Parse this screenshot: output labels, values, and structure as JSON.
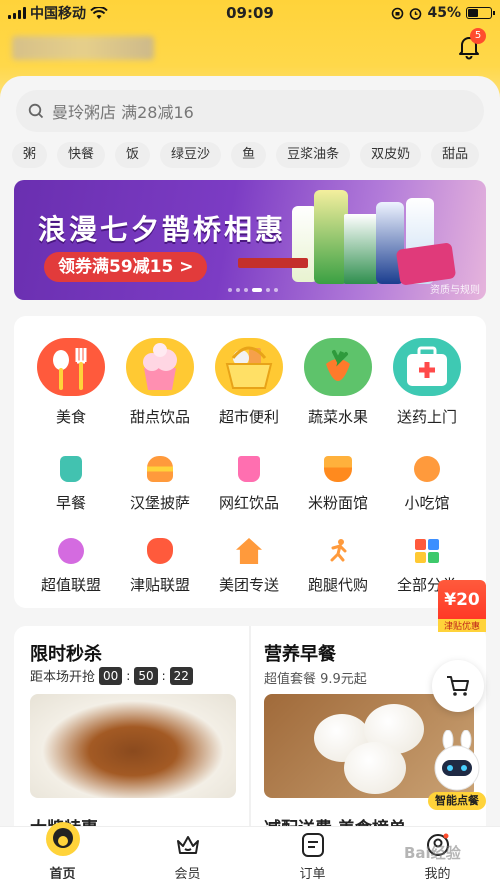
{
  "status_bar": {
    "carrier": "中国移动",
    "time": "09:09",
    "battery": "45%"
  },
  "header": {
    "notification_count": "5"
  },
  "search": {
    "placeholder": "曼玲粥店 满28减16"
  },
  "chips": [
    "粥",
    "快餐",
    "饭",
    "绿豆沙",
    "鱼",
    "豆浆油条",
    "双皮奶",
    "甜品"
  ],
  "banner": {
    "title": "浪漫七夕鹊桥相惠",
    "button": "领券满59减15 >",
    "note": "资质与规则"
  },
  "categories_main": [
    {
      "label": "美食",
      "color": "#ff5a3c"
    },
    {
      "label": "甜点饮品",
      "color": "#ffc933"
    },
    {
      "label": "超市便利",
      "color": "#ffc933"
    },
    {
      "label": "蔬菜水果",
      "color": "#5ec36b"
    },
    {
      "label": "送药上门",
      "color": "#3ec9b3"
    }
  ],
  "categories_row2": [
    "早餐",
    "汉堡披萨",
    "网红饮品",
    "米粉面馆",
    "小吃馆"
  ],
  "categories_row3": [
    "超值联盟",
    "津贴联盟",
    "美团专送",
    "跑腿代购",
    "全部分类"
  ],
  "flash_sale": {
    "title": "限时秒杀",
    "countdown_label": "距本场开抢",
    "hours": "00",
    "minutes": "50",
    "seconds": "22",
    "bottom_text": "大牌特惠"
  },
  "breakfast": {
    "title": "营养早餐",
    "subtitle": "超值套餐 9.9元起",
    "bottom_text": "减配送费  美食榜单"
  },
  "float": {
    "red_packet_amount": "¥20",
    "red_packet_label": "津贴优惠",
    "assistant_label": "智能点餐"
  },
  "tabbar": [
    {
      "label": "首页",
      "active": true
    },
    {
      "label": "会员",
      "active": false
    },
    {
      "label": "订单",
      "active": false
    },
    {
      "label": "我的",
      "active": false
    }
  ],
  "watermark": "Bai经验"
}
